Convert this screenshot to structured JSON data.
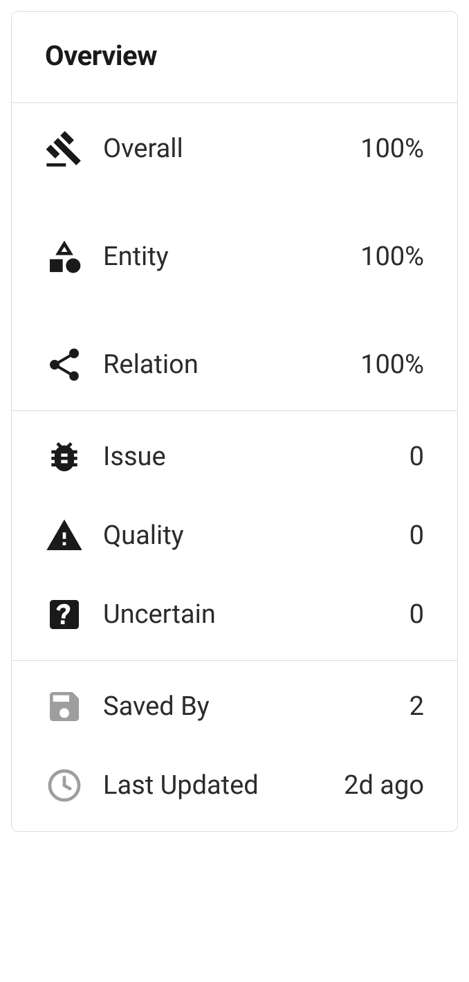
{
  "title": "Overview",
  "section1": {
    "overall": {
      "label": "Overall",
      "value": "100%"
    },
    "entity": {
      "label": "Entity",
      "value": "100%"
    },
    "relation": {
      "label": "Relation",
      "value": "100%"
    }
  },
  "section2": {
    "issue": {
      "label": "Issue",
      "value": "0"
    },
    "quality": {
      "label": "Quality",
      "value": "0"
    },
    "uncertain": {
      "label": "Uncertain",
      "value": "0"
    }
  },
  "section3": {
    "savedBy": {
      "label": "Saved By",
      "value": "2"
    },
    "lastUpdated": {
      "label": "Last Updated",
      "value": "2d ago"
    }
  }
}
